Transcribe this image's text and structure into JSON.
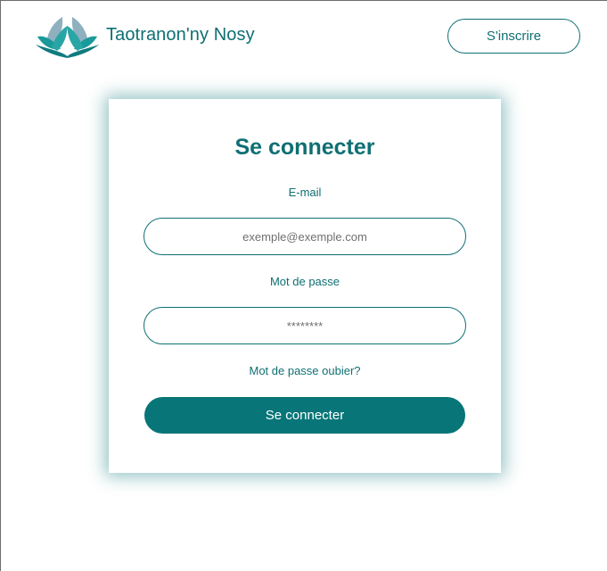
{
  "header": {
    "brand_name": "Taotranon'ny Nosy",
    "logo_icon": "lotus-leaves-icon",
    "signup_label": "S'inscrire"
  },
  "login": {
    "title": "Se connecter",
    "email_label": "E-mail",
    "email_placeholder": "exemple@exemple.com",
    "email_value": "",
    "password_label": "Mot de passe",
    "password_placeholder": "********",
    "password_value": "",
    "forgot_label": "Mot de passe oubier?",
    "submit_label": "Se connecter"
  },
  "colors": {
    "brand": "#0f6f73",
    "button": "#087578",
    "logo_light": "#8fb0bf",
    "logo_dark": "#148a8a"
  }
}
